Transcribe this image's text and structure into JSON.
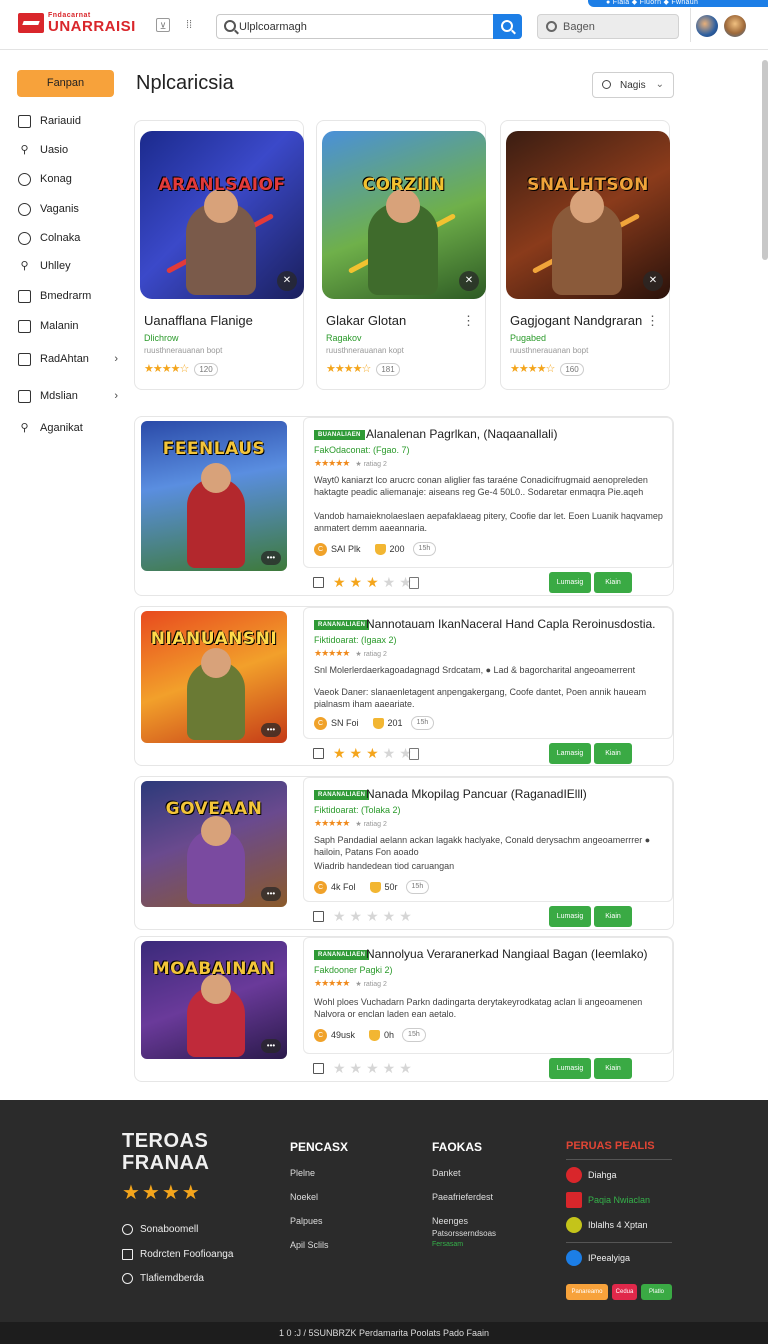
{
  "header": {
    "logo_small": "Fndacarnat",
    "logo_big": "UNARRAISI",
    "search_value": "Ulplcoarmagh",
    "region_label": "Bagen",
    "top_strip": "● Flala   ◆ Fluorn   ◆ Fwnaun"
  },
  "sidebar": {
    "primary_button": "Fanpan",
    "items": [
      {
        "label": "Rariauid",
        "icon": "sq"
      },
      {
        "label": "Uasio",
        "icon": "search"
      },
      {
        "label": "Konag",
        "icon": "ci"
      },
      {
        "label": "Vaganis",
        "icon": "ci"
      },
      {
        "label": "Colnaka",
        "icon": "ci"
      },
      {
        "label": "Uhlley",
        "icon": "search"
      },
      {
        "label": "Bmedrarm",
        "icon": "sq"
      },
      {
        "label": "Malanin",
        "icon": "sq"
      },
      {
        "label": "RadAhtan",
        "icon": "sq",
        "chevron": true
      },
      {
        "label": "Mdslian",
        "icon": "sq",
        "chevron": true
      },
      {
        "label": "Aganikat",
        "icon": "search"
      }
    ]
  },
  "main": {
    "title": "Nplcaricsia",
    "sort_label": "Nagis",
    "featured": [
      {
        "art_title": "ARANLSAIOF",
        "name": "Uanafflana Flanige",
        "developer": "Dlichrow",
        "subtitle": "ruusthnerauanan bopt",
        "rating": 4,
        "count": "120",
        "bg": "linear-gradient(135deg,#1b2a8c 0%,#3b49c9 45%,#1a1f5c 100%)",
        "accent": "#e23a3a",
        "hero": "#7a5a4a"
      },
      {
        "art_title": "CORZIIN",
        "name": "Glakar Glotan",
        "developer": "Ragakov",
        "subtitle": "ruusthnerauanan kopt",
        "rating": 4,
        "count": "181",
        "bg": "linear-gradient(160deg,#4a90d9 0%,#6fb04a 55%,#2d5a24 100%)",
        "accent": "#f2c230",
        "hero": "#3f6b2c"
      },
      {
        "art_title": "SNALHTSON",
        "name": "Gagjogant Nandgraran",
        "developer": "Pugabed",
        "subtitle": "ruusthnerauanan bopt",
        "rating": 4,
        "count": "160",
        "bg": "linear-gradient(150deg,#3a1d12 0%,#8a3b1b 50%,#2a120b 100%)",
        "accent": "#f0a43a",
        "hero": "#8a5a3a"
      }
    ],
    "list": [
      {
        "art_title": "FEENLAUS",
        "tag": "BUANALIAEN",
        "title": "Alanalenan Pagrlkan, (Naqaanallali)",
        "sub": "FakOdaconat: (Fgao. 7)",
        "desc1": "Wayt0 kaniarzt lco arucrc conan aliglier fas taraéne Conadicifrugmaid aenopreleden haktagte peadic aliemanaje: aiseans reg Ge-4 50L0.. Sodaretar enmaqra Pie.aqeh",
        "desc2": "Vandob hamaieknolaeslaen aepafaklaeag pitery, Coofie dar let. Eoen Luanik haqvamep anmatert demm aaeannaria.",
        "coins": "SAI Plk",
        "trophy": "200",
        "pill": "15h",
        "rating": 3,
        "btn1": "Lumasig",
        "btn2": "Kiain",
        "bg": "linear-gradient(170deg,#2a4aa8 0%,#5a8ee0 40%,#3e7a3a 100%)",
        "accent": "#f3c53a",
        "hero": "#b3282d"
      },
      {
        "art_title": "NIANUANSNI",
        "tag": "RANANALIAEN",
        "title": "Nannotauam IkanNaceral Hand Capla Reroinusdostia.",
        "sub": "Fiktidoarat: (Igaax 2)",
        "desc1": "Snl Molerlerdaerkagoadagnagd Srdcatam, ● Lad & bagorcharital angeoamerrent",
        "desc2": "Vaeok Daner: slanaenletagent anpengakergang, Coofe dantet, Poen annik haueam pialnasm iham aaeariate.",
        "coins": "SN Foi",
        "trophy": "201",
        "pill": "15h",
        "rating": 3,
        "btn1": "Lamasig",
        "btn2": "Kiain",
        "bg": "linear-gradient(160deg,#e84a1e 0%,#f2a02b 50%,#c43a17 100%)",
        "accent": "#ffd94a",
        "hero": "#6a7a34"
      },
      {
        "art_title": "GOVEAAN",
        "tag": "RANANALIAEN",
        "title": "Nanada Mkopilag Pancuar (RaganadIElll)",
        "sub": "Fiktidoarat: (Tolaka 2)",
        "desc1": "Saph Pandadial aelann ackan lagakk haclyake, Conald derysachm angeoamerrrer ● hailoin, Patans Fon aoado",
        "desc2": "Wiadrib handedean tiod caruangan",
        "coins": "4k Fol",
        "trophy": "50r",
        "pill": "15h",
        "rating": 0,
        "btn1": "Lumasig",
        "btn2": "Kiain",
        "bg": "linear-gradient(160deg,#2c3a7a 0%,#6a4a8e 45%,#8a5a2a 100%)",
        "accent": "#f3c53a",
        "hero": "#7a4aa0"
      },
      {
        "art_title": "MOABAINAN",
        "tag": "RANANALIAEN",
        "title": "Nannolyua Veraranerkad Nangiaal Bagan (Ieemlako)",
        "sub": "Fakdooner Pagki 2)",
        "desc1": "Wohl ploes Vuchadarn Parkn dadingarta derytakeyrodkatag aclan li angeoamenen",
        "desc2": "Nalvora or enclan laden ean aetalo.",
        "coins": "49usk",
        "trophy": "0h",
        "pill": "15h",
        "rating": 0,
        "btn1": "Lumasig",
        "btn2": "Kiain",
        "bg": "linear-gradient(160deg,#3a2a7a 0%,#6a3a9a 50%,#2a1a4a 100%)",
        "accent": "#f3c53a",
        "hero": "#c02a3a"
      }
    ]
  },
  "footer": {
    "brand_line1": "TEROAS",
    "brand_line2": "FRANAA",
    "brand_links": [
      "Sonaboomell",
      "Rodrcten Foofioanga",
      "Tlafiemdberda"
    ],
    "col1_head": "PENCASX",
    "col1_items": [
      "Plelne",
      "Noekel",
      "Palpues",
      "Apil Sclils"
    ],
    "col2_head": "FAOKAS",
    "col2_items": [
      "Danket",
      "Paeafrieferdest",
      "Neenges",
      "Patsorsserndsoas"
    ],
    "col2_green": "Fersasam",
    "partners_head": "PERUAS PEALIS",
    "partners": [
      {
        "label": "Diahga",
        "color": "#d9262b"
      },
      {
        "label": "Paqia Nwiaclan",
        "color": "#d9262b",
        "green_prefix": "Paqia"
      },
      {
        "label": "Iblalhs 4 Xptan",
        "color": "#c4c41a"
      },
      {
        "label": "IPeealyiga",
        "color": "#1c7ee6"
      }
    ],
    "badges": [
      {
        "label": "Panareamo",
        "color": "#f7a23b"
      },
      {
        "label": "Cedua",
        "color": "#e0284a"
      },
      {
        "label": "Platlo",
        "color": "#3aaa44"
      }
    ],
    "bottom": "1 0 :J  /  5SUNBRZK  Perdamarita  Poolats  Pado Faain"
  }
}
